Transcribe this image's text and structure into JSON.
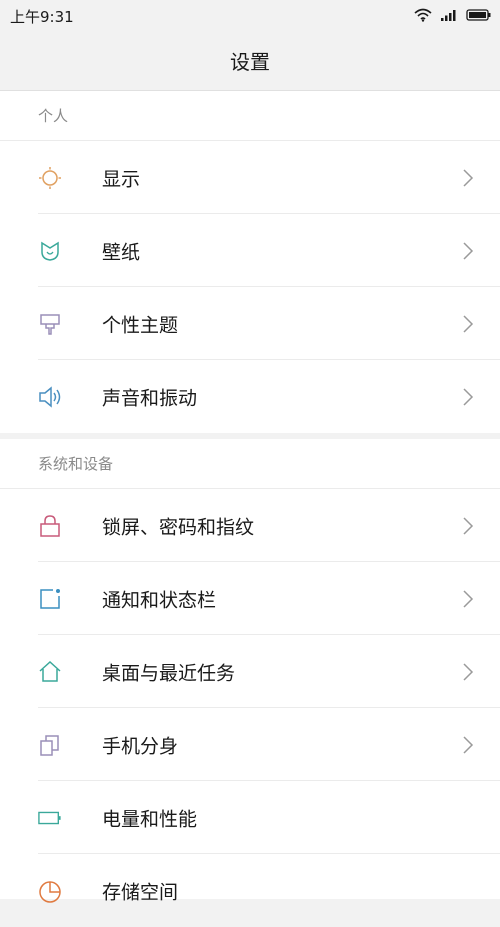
{
  "status_bar": {
    "time": "上午9:31",
    "icons": [
      "wifi-icon",
      "signal-icon",
      "battery-icon"
    ]
  },
  "header": {
    "title": "设置"
  },
  "sections": [
    {
      "header": "个人",
      "items": [
        {
          "label": "显示",
          "icon": "sun-icon",
          "icon_color": "#e0a060"
        },
        {
          "label": "壁纸",
          "icon": "tulip-icon",
          "icon_color": "#3aa89a"
        },
        {
          "label": "个性主题",
          "icon": "brush-icon",
          "icon_color": "#9a8fb8"
        },
        {
          "label": "声音和振动",
          "icon": "speaker-icon",
          "icon_color": "#4a8fc0"
        }
      ]
    },
    {
      "header": "系统和设备",
      "items": [
        {
          "label": "锁屏、密码和指纹",
          "icon": "lock-icon",
          "icon_color": "#c85a7a"
        },
        {
          "label": "通知和状态栏",
          "icon": "notification-icon",
          "icon_color": "#3a8fc0"
        },
        {
          "label": "桌面与最近任务",
          "icon": "home-icon",
          "icon_color": "#3aa89a"
        },
        {
          "label": "手机分身",
          "icon": "dual-phone-icon",
          "icon_color": "#9a8fb8"
        },
        {
          "label": "电量和性能",
          "icon": "battery-icon",
          "icon_color": "#3aa89a"
        },
        {
          "label": "存储空间",
          "icon": "pie-icon",
          "icon_color": "#e07a40"
        }
      ]
    }
  ]
}
